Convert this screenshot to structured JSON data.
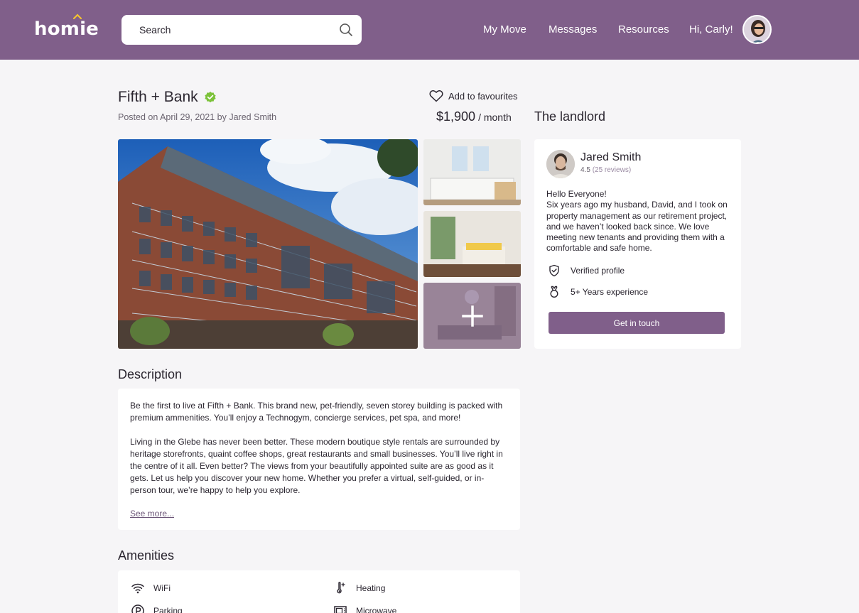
{
  "header": {
    "logo": "homie",
    "search_placeholder": "Search",
    "nav": [
      "My Move",
      "Messages",
      "Resources",
      "Hi, Carly!"
    ]
  },
  "listing": {
    "title": "Fifth + Bank",
    "posted": "Posted on April 29, 2021 by Jared Smith",
    "favourite_label": "Add to favourites",
    "price": "$1,900",
    "price_period": "/ month"
  },
  "landlord": {
    "heading": "The landlord",
    "name": "Jared Smith",
    "rating": "4.5",
    "reviews": "(25 reviews)",
    "bio_greeting": "Hello Everyone!",
    "bio": "Six years ago my husband, David, and I took on property management as our retirement project, and we haven’t looked back since. We love meeting new tenants and providing them with a comfortable and safe home.",
    "features": [
      "Verified profile",
      "5+ Years experience"
    ],
    "cta": "Get in touch"
  },
  "description": {
    "heading": "Description",
    "paragraph1": "Be the first to live at Fifth + Bank. This brand new, pet-friendly, seven storey building is packed with premium ammenities. You’ll enjoy a Technogym, concierge services, pet spa, and more!",
    "paragraph2": "Living in the Glebe has never been better. These modern boutique style rentals are surrounded by heritage storefronts, quaint coffee shops, great restaurants and small businesses. You’ll live right in the centre of it all. Even better? The views from your beautifully appointed suite are as good as it gets.  Let us help you discover your new home. Whether you prefer a virtual, self-guided, or in-person tour, we’re happy to help you explore.",
    "see_more": "See more..."
  },
  "amenities": {
    "heading": "Amenities",
    "items": [
      "WiFi",
      "Heating",
      "Parking",
      "Microwave"
    ]
  },
  "colors": {
    "brand": "#805f8a",
    "verified_green": "#7cc23a",
    "background": "#f6f5f7"
  },
  "icons": [
    "search-icon",
    "verified-check-icon",
    "heart-icon",
    "shield-check-icon",
    "medal-icon",
    "wifi-icon",
    "thermometer-icon",
    "parking-icon",
    "microwave-icon",
    "plus-icon"
  ]
}
